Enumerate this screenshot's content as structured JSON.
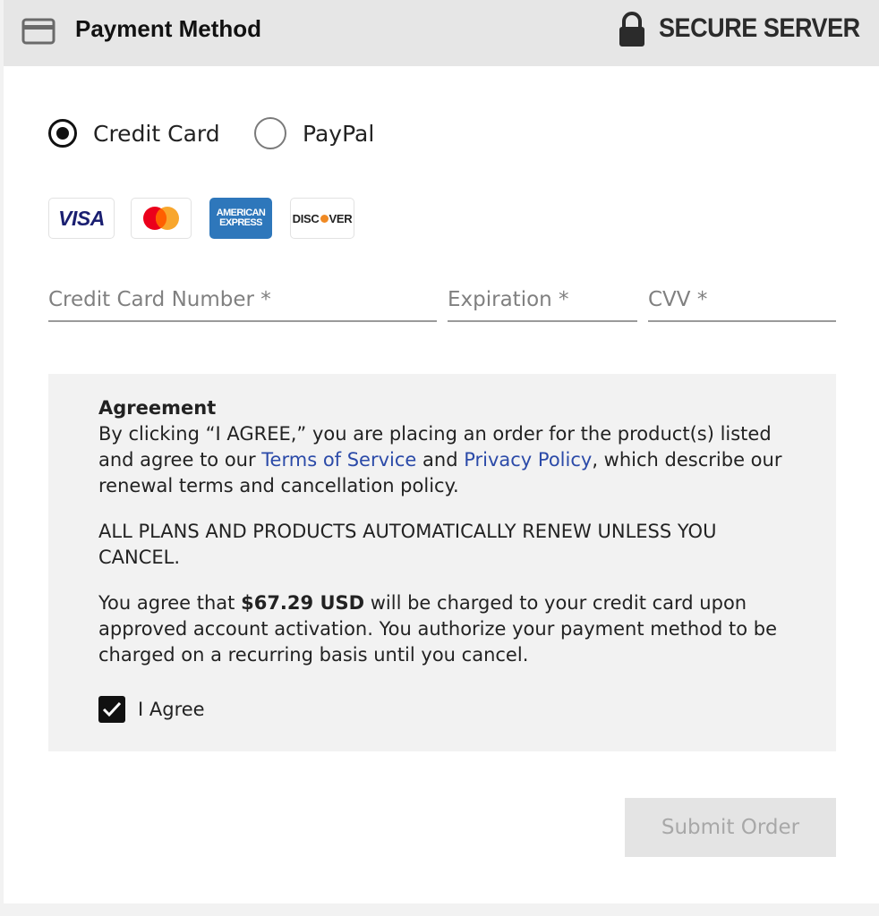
{
  "header": {
    "title": "Payment Method",
    "secure_label": "SECURE SERVER"
  },
  "payment_options": {
    "credit_card_label": "Credit Card",
    "paypal_label": "PayPal",
    "selected": "Credit Card"
  },
  "card_logos": {
    "visa": "VISA",
    "amex_line1": "AMERICAN",
    "amex_line2": "EXPRESS",
    "discover_a": "DISC",
    "discover_b": "VER"
  },
  "fields": {
    "card_number_placeholder": "Credit Card Number *",
    "expiration_placeholder": "Expiration *",
    "cvv_placeholder": "CVV *"
  },
  "agreement": {
    "title": "Agreement",
    "p1_start": "By clicking “I AGREE,” you are placing an order for the product(s) listed and agree to our ",
    "terms_link": "Terms of Service",
    "p1_and": " and ",
    "privacy_link": "Privacy Policy",
    "p1_end": ", which describe our renewal terms and cancellation policy.",
    "p2": "ALL PLANS AND PRODUCTS AUTOMATICALLY RENEW UNLESS YOU CANCEL.",
    "p3_start": "You agree that ",
    "amount": "$67.29 USD",
    "p3_end": " will be charged to your credit card upon approved account activation. You authorize your payment method to be charged on a recurring basis until you cancel.",
    "checkbox_label": "I Agree",
    "checked": true
  },
  "submit_label": "Submit Order",
  "colors": {
    "header_bg": "#e6e6e6",
    "link": "#2b4aa8",
    "agreement_bg": "#f2f2f2",
    "submit_disabled_bg": "#e4e4e4",
    "amex_blue": "#2e77bb",
    "mastercard_red": "#eb001b",
    "mastercard_orange": "#f79e1b"
  }
}
